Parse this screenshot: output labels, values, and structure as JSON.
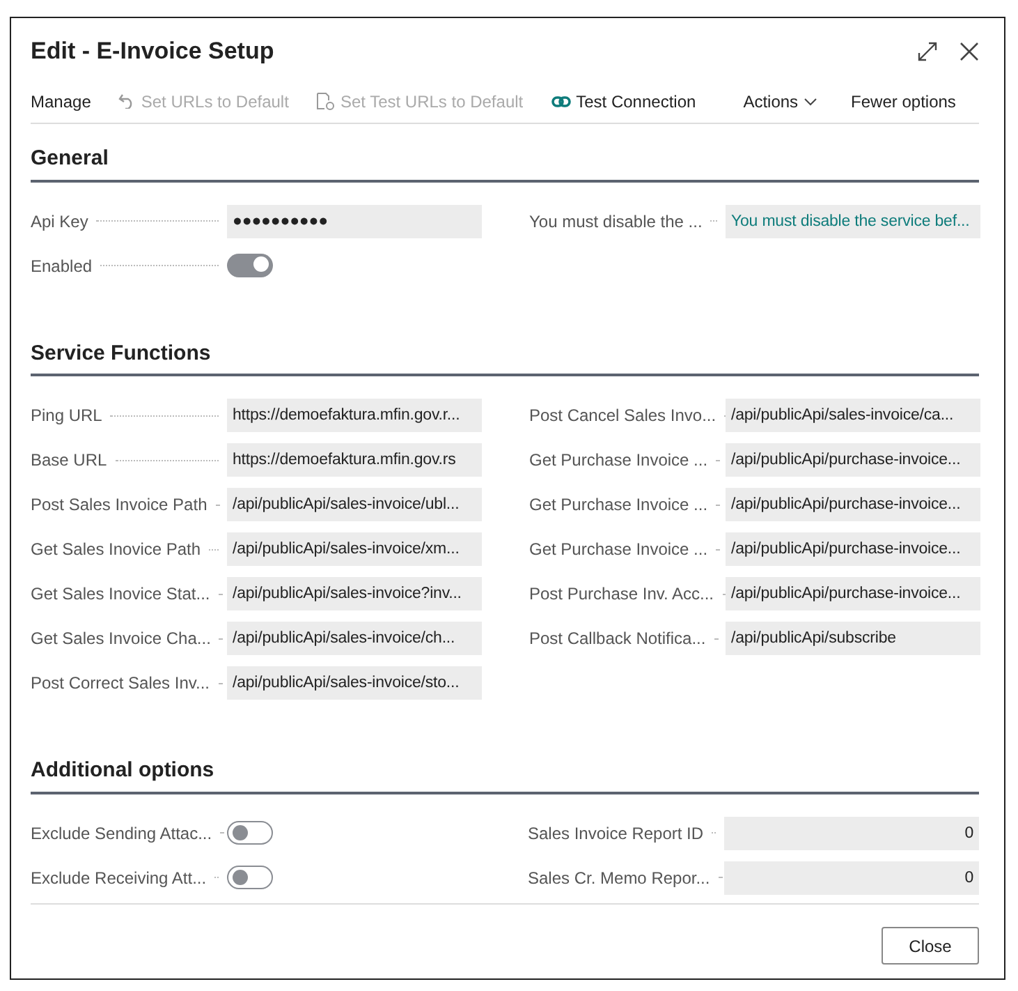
{
  "window": {
    "title": "Edit - E-Invoice Setup"
  },
  "toolbar": [
    {
      "label": "Manage",
      "kind": "text",
      "disabled": false
    },
    {
      "label": "Set URLs to Default",
      "kind": "undo",
      "disabled": true
    },
    {
      "label": "Set Test URLs to Default",
      "kind": "document",
      "disabled": true
    },
    {
      "label": "Test Connection",
      "kind": "link",
      "disabled": false
    },
    {
      "label": "Actions",
      "kind": "menu",
      "disabled": false
    },
    {
      "label": "Fewer options",
      "kind": "text",
      "disabled": false
    }
  ],
  "sections": [
    {
      "title": "General",
      "left": [
        {
          "label": "Api Key",
          "kind": "text",
          "value": "●●●●●●●●●●"
        },
        {
          "label": "Enabled",
          "kind": "toggle",
          "on": true
        }
      ],
      "right": [
        {
          "label": "You must disable the ...",
          "kind": "link",
          "value": "You must disable the service bef..."
        }
      ]
    },
    {
      "title": "Service Functions",
      "left": [
        {
          "label": "Ping URL",
          "kind": "text",
          "value": "https://demoefaktura.mfin.gov.r..."
        },
        {
          "label": "Base URL",
          "kind": "text",
          "value": "https://demoefaktura.mfin.gov.rs"
        },
        {
          "label": "Post Sales Invoice Path",
          "kind": "text",
          "value": "/api/publicApi/sales-invoice/ubl..."
        },
        {
          "label": "Get Sales Inovice Path",
          "kind": "text",
          "value": "/api/publicApi/sales-invoice/xm..."
        },
        {
          "label": "Get Sales Inovice Stat...",
          "kind": "text",
          "value": "/api/publicApi/sales-invoice?inv..."
        },
        {
          "label": "Get Sales Invoice Cha...",
          "kind": "text",
          "value": "/api/publicApi/sales-invoice/ch..."
        },
        {
          "label": "Post Correct Sales Inv...",
          "kind": "text",
          "value": "/api/publicApi/sales-invoice/sto..."
        }
      ],
      "right": [
        {
          "label": "Post Cancel Sales Invo...",
          "kind": "text",
          "value": "/api/publicApi/sales-invoice/ca..."
        },
        {
          "label": "Get Purchase Invoice ...",
          "kind": "text",
          "value": "/api/publicApi/purchase-invoice..."
        },
        {
          "label": "Get Purchase Invoice ...",
          "kind": "text",
          "value": "/api/publicApi/purchase-invoice..."
        },
        {
          "label": "Get Purchase Invoice ...",
          "kind": "text",
          "value": "/api/publicApi/purchase-invoice..."
        },
        {
          "label": "Post Purchase Inv. Acc...",
          "kind": "text",
          "value": "/api/publicApi/purchase-invoice..."
        },
        {
          "label": "Post Callback Notifica...",
          "kind": "text",
          "value": "/api/publicApi/subscribe"
        }
      ]
    },
    {
      "title": "Additional options",
      "left": [
        {
          "label": "Exclude Sending Attac...",
          "kind": "toggle",
          "on": false
        },
        {
          "label": "Exclude Receiving Att...",
          "kind": "toggle",
          "on": false
        }
      ],
      "right": [
        {
          "label": "Sales Invoice Report ID",
          "kind": "number",
          "value": "0"
        },
        {
          "label": "Sales Cr. Memo Repor...",
          "kind": "number",
          "value": "0"
        }
      ]
    }
  ],
  "buttons": [
    "Close"
  ]
}
